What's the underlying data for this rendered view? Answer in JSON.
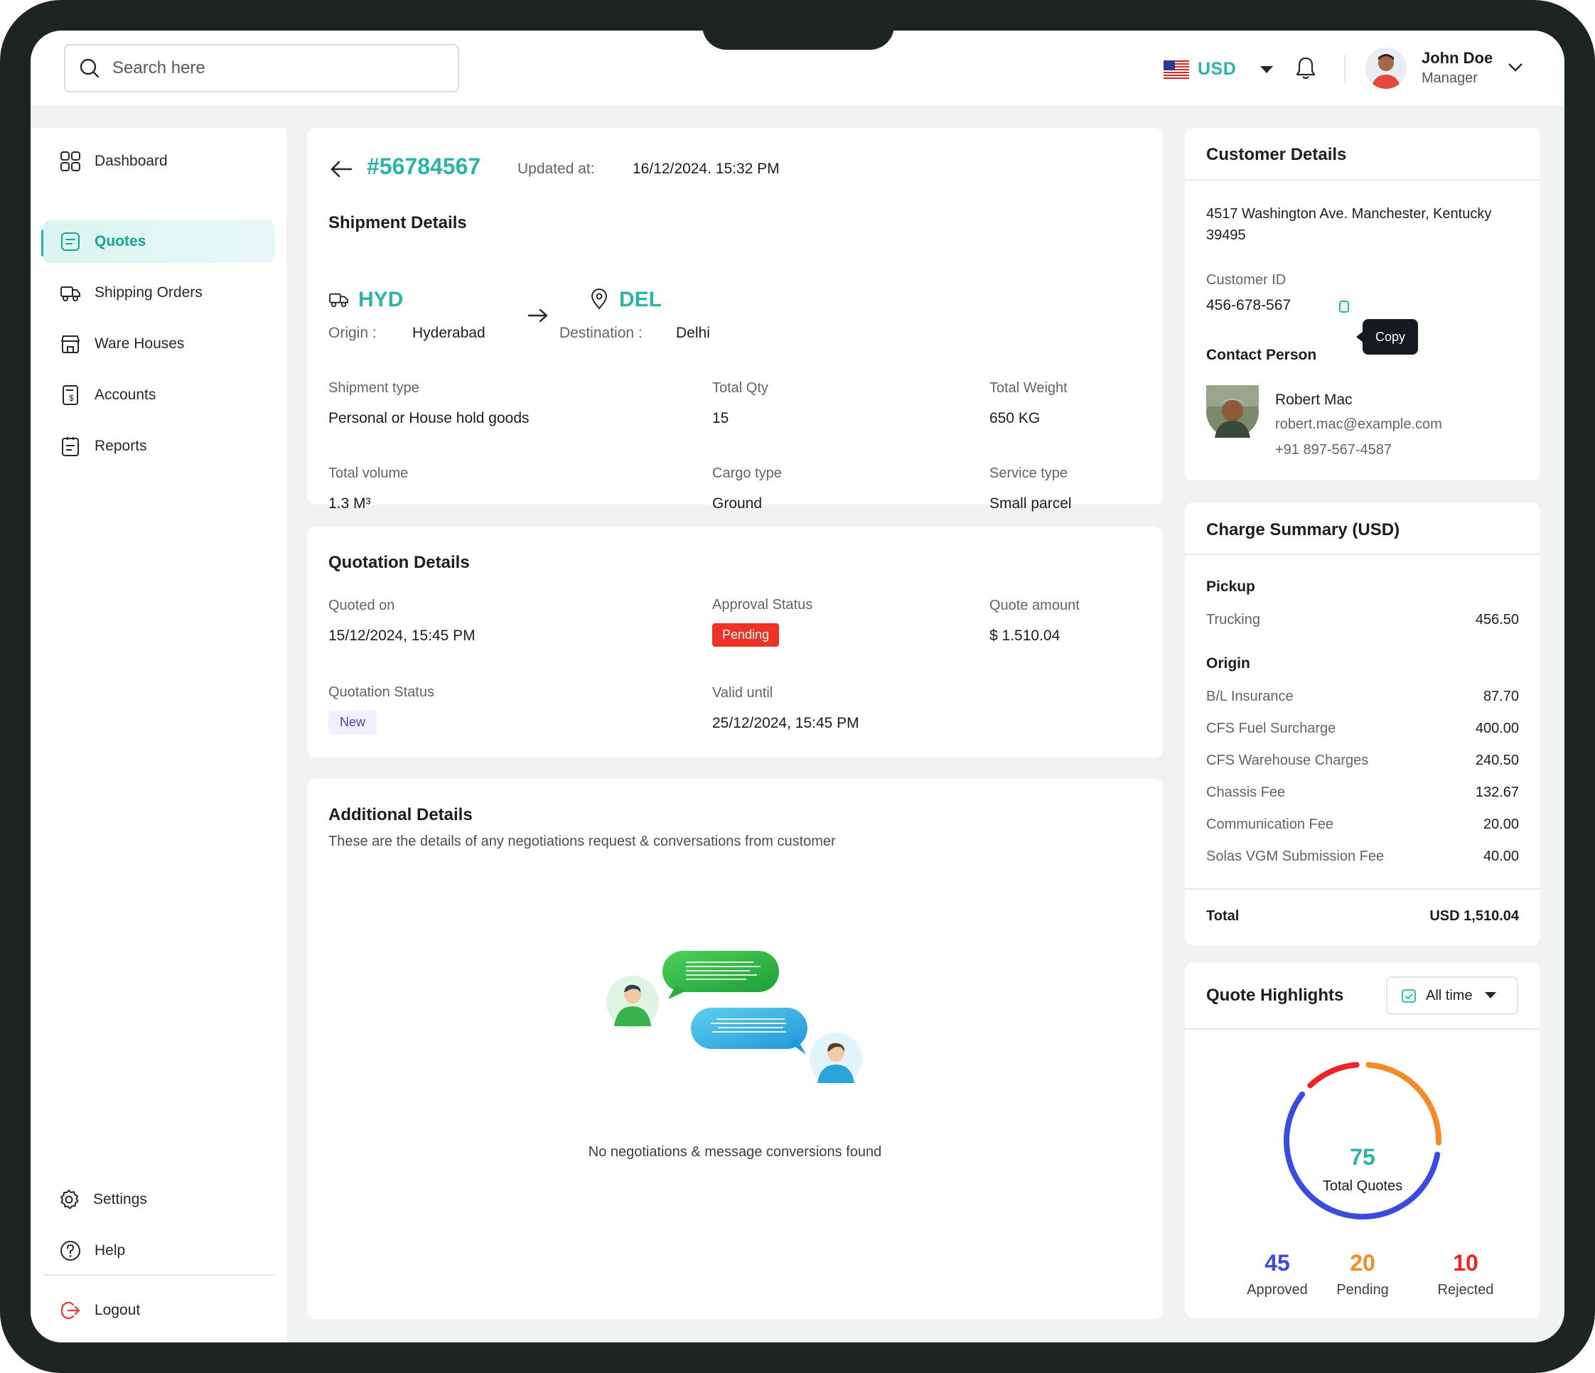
{
  "topbar": {
    "search_placeholder": "Search here",
    "currency": "USD",
    "user": {
      "name": "John Doe",
      "role": "Manager"
    }
  },
  "sidebar": {
    "items": [
      {
        "label": "Dashboard",
        "icon": "grid-icon"
      },
      {
        "label": "Quotes",
        "icon": "quote-doc-icon",
        "active": true
      },
      {
        "label": "Shipping Orders",
        "icon": "truck-icon"
      },
      {
        "label": "Ware Houses",
        "icon": "warehouse-icon"
      },
      {
        "label": "Accounts",
        "icon": "invoice-icon"
      },
      {
        "label": "Reports",
        "icon": "report-icon"
      }
    ],
    "bottom": {
      "settings": "Settings",
      "help": "Help",
      "logout": "Logout"
    }
  },
  "quote": {
    "id": "#56784567",
    "updated_label": "Updated at:",
    "updated_value": "16/12/2024. 15:32 PM"
  },
  "shipment": {
    "title": "Shipment Details",
    "origin_code": "HYD",
    "origin_label": "Origin :",
    "origin_city": "Hyderabad",
    "dest_code": "DEL",
    "dest_label": "Destination :",
    "dest_city": "Delhi",
    "fields": [
      {
        "label": "Shipment type",
        "value": "Personal or House hold goods"
      },
      {
        "label": "Total Qty",
        "value": "15"
      },
      {
        "label": "Total Weight",
        "value": "650 KG"
      },
      {
        "label": "Total volume",
        "value": "1.3 M³"
      },
      {
        "label": "Cargo type",
        "value": "Ground"
      },
      {
        "label": "Service type",
        "value": "Small parcel"
      }
    ]
  },
  "quotation": {
    "title": "Quotation Details",
    "quoted_on_label": "Quoted on",
    "quoted_on": "15/12/2024, 15:45 PM",
    "approval_label": "Approval Status",
    "approval": "Pending",
    "amount_label": "Quote amount",
    "amount": "$ 1.510.04",
    "status_label": "Quotation Status",
    "status": "New",
    "valid_label": "Valid until",
    "valid": "25/12/2024, 15:45 PM"
  },
  "additional": {
    "title": "Additional Details",
    "subtitle": "These are the details of any negotiations request & conversations from customer",
    "empty": "No negotiations & message conversions found"
  },
  "customer": {
    "title": "Customer Details",
    "address": "4517 Washington Ave. Manchester, Kentucky 39495",
    "id_label": "Customer ID",
    "id": "456-678-567",
    "copy": "Copy",
    "contact_title": "Contact Person",
    "contact_name": "Robert Mac",
    "contact_email": "robert.mac@example.com",
    "contact_phone": "+91 897-567-4587"
  },
  "charges": {
    "title": "Charge Summary (USD)",
    "pickup": "Pickup",
    "trucking_label": "Trucking",
    "trucking": "456.50",
    "origin": "Origin",
    "items": [
      {
        "label": "B/L Insurance",
        "value": "87.70"
      },
      {
        "label": "CFS Fuel Surcharge",
        "value": "400.00"
      },
      {
        "label": "CFS Warehouse Charges",
        "value": "240.50"
      },
      {
        "label": "Chassis Fee",
        "value": "132.67"
      },
      {
        "label": "Communication Fee",
        "value": "20.00"
      },
      {
        "label": "Solas VGM Submission Fee",
        "value": "40.00"
      }
    ],
    "total_label": "Total",
    "total": "USD 1,510.04"
  },
  "highlights": {
    "title": "Quote Highlights",
    "filter": "All time",
    "total": "75",
    "total_label": "Total Quotes",
    "approved": "45",
    "approved_label": "Approved",
    "pending": "20",
    "pending_label": "Pending",
    "rejected": "10",
    "rejected_label": "Rejected",
    "colors": {
      "approved": "#3b4be0",
      "pending": "#f48b2a",
      "rejected": "#ef2323",
      "total": "#2bb5a8"
    }
  }
}
